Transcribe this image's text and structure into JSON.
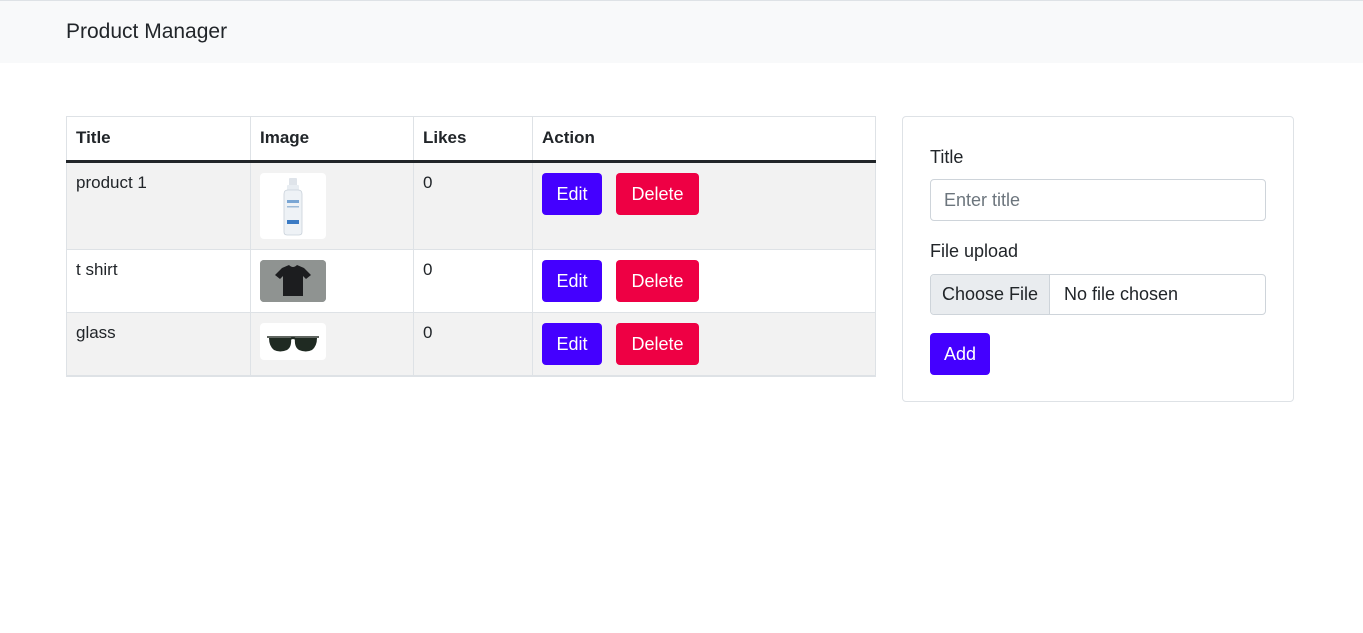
{
  "navbar": {
    "brand": "Product Manager"
  },
  "table": {
    "headers": [
      "Title",
      "Image",
      "Likes",
      "Action"
    ],
    "rows": [
      {
        "title": "product 1",
        "image": "bottle-image",
        "likes": "0",
        "edit_label": "Edit",
        "delete_label": "Delete"
      },
      {
        "title": "t shirt",
        "image": "tshirt-image",
        "likes": "0",
        "edit_label": "Edit",
        "delete_label": "Delete"
      },
      {
        "title": "glass",
        "image": "sunglasses-image",
        "likes": "0",
        "edit_label": "Edit",
        "delete_label": "Delete"
      }
    ]
  },
  "form": {
    "title_label": "Title",
    "title_placeholder": "Enter title",
    "title_value": "",
    "file_label": "File upload",
    "file_button": "Choose File",
    "file_status": "No file chosen",
    "submit_label": "Add"
  },
  "colors": {
    "primary": "#4400ff",
    "danger": "#ee0044",
    "navbar_bg": "#f8f9fa",
    "stripe": "#f2f2f2"
  }
}
